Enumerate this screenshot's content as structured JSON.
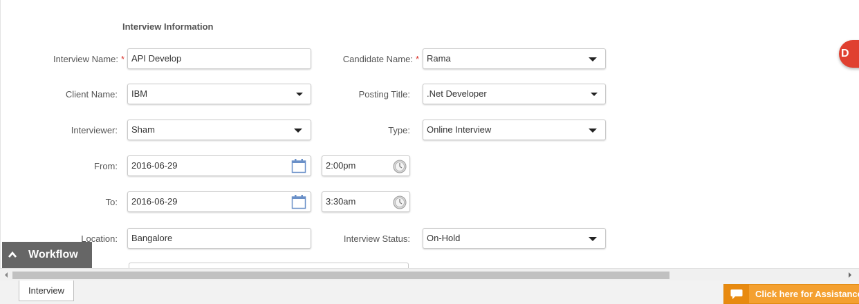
{
  "section": {
    "title": "Interview Information"
  },
  "form": {
    "interview_name": {
      "label": "Interview Name:",
      "value": "API Develop",
      "required": true
    },
    "candidate_name": {
      "label": "Candidate Name:",
      "value": "Rama",
      "required": true
    },
    "client_name": {
      "label": "Client Name:",
      "value": "IBM"
    },
    "posting_title": {
      "label": "Posting Title:",
      "value": ".Net Developer"
    },
    "interviewer": {
      "label": "Interviewer:",
      "value": "Sham"
    },
    "type": {
      "label": "Type:",
      "value": "Online Interview"
    },
    "from": {
      "label": "From:",
      "date": "2016-06-29",
      "time": "2:00pm"
    },
    "to": {
      "label": "To:",
      "date": "2016-06-29",
      "time": "3:30am"
    },
    "location": {
      "label": "Location:",
      "value": "Bangalore"
    },
    "interview_status": {
      "label": "Interview Status:",
      "value": "On-Hold"
    },
    "required_mark": "*"
  },
  "badge": {
    "letter": "D"
  },
  "workflow": {
    "label": "Workflow"
  },
  "tabs": [
    {
      "label": "Interview"
    }
  ],
  "assistance": {
    "label": "Click here for Assistance"
  },
  "colors": {
    "required": "#d9332b",
    "badge": "#e04030",
    "assist": "#f4a030",
    "workflow": "#666666"
  },
  "icons": [
    "calendar-icon",
    "clock-icon",
    "chevron-up-icon",
    "chat-icon",
    "dropdown-caret-icon"
  ]
}
